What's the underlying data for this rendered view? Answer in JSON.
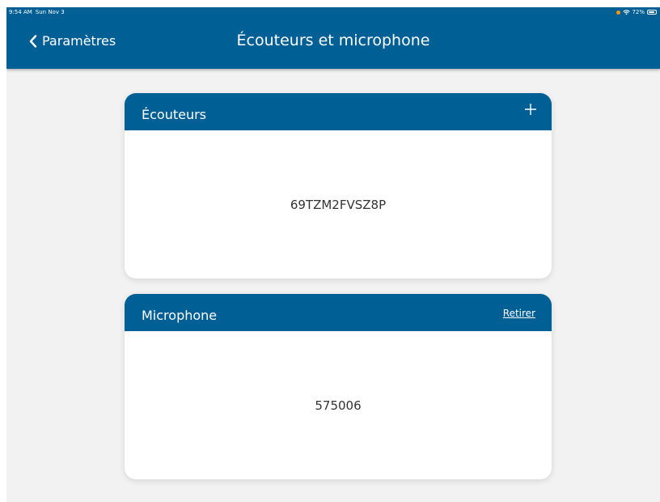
{
  "status_bar": {
    "time": "9:54 AM",
    "date": "Sun Nov 3",
    "battery": "72%"
  },
  "nav": {
    "back_label": "Paramètres",
    "title": "Écouteurs et microphone"
  },
  "headphones_card": {
    "title": "Écouteurs",
    "value": "69TZM2FVSZ8P"
  },
  "microphone_card": {
    "title": "Microphone",
    "remove_label": "Retirer",
    "value": "575006"
  },
  "colors": {
    "brand": "#005f94",
    "background": "#f2f2f2",
    "card": "#ffffff",
    "status_dot": "#ff9500"
  },
  "icons": [
    "chevron-left-icon",
    "plus-icon",
    "wifi-icon",
    "battery-icon"
  ]
}
